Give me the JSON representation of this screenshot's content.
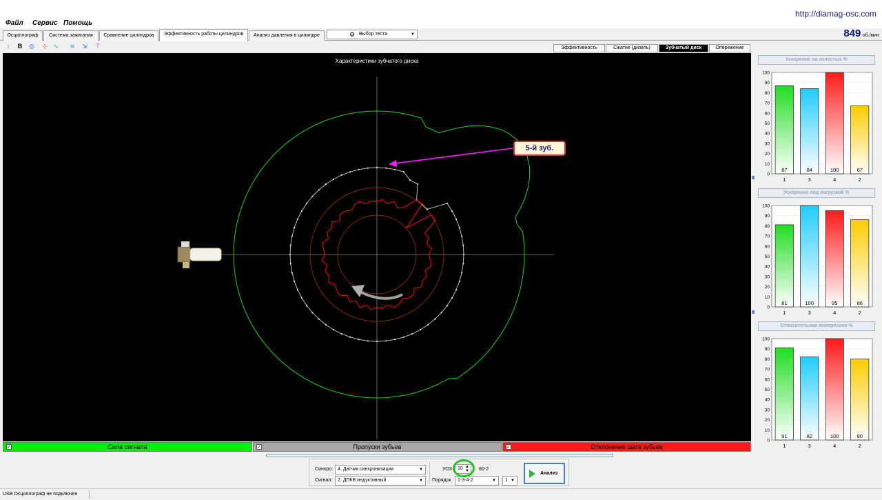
{
  "site_url": "http://diamag-osc.com",
  "menu": [
    "Файл",
    "Сервис",
    "Помощь"
  ],
  "tabs": [
    "Осциллограф",
    "Система зажигания",
    "Сравнение цилиндров",
    "Эффективность работы цилиндров",
    "Анализ давления в цилиндре"
  ],
  "active_tab": 3,
  "test_select": {
    "value": "Выбор теста",
    "icon": "gear-icon"
  },
  "rpm": {
    "value": "849",
    "unit": "об./мин"
  },
  "toolbar_icons": [
    "adjust-icon",
    "bold-b-icon",
    "zoom-icon",
    "cursor-icon",
    "graph-icon",
    "filter-icon",
    "scale-icon",
    "marker-icon"
  ],
  "subtabs": [
    "Эффективность",
    "Сжатие (дизель)",
    "Зубчатый диск",
    "Опережение"
  ],
  "active_subtab": 2,
  "plot": {
    "title": "Характеристики зубчатого диска",
    "callout": "5-й зуб."
  },
  "legend": [
    {
      "label": "Сила сигнала",
      "color": "#00ee00",
      "checked": "✓"
    },
    {
      "label": "Пропуски зубьев",
      "color": "#a0a0a0",
      "checked": "✓"
    },
    {
      "label": "Отклонение шага зубьев",
      "color": "#ff1a1a",
      "checked": "✓"
    }
  ],
  "controls": {
    "sync_label": "Синхро:",
    "sync_value": "4. Датчик синхронизации",
    "signal_label": "Сигнал:",
    "signal_value": "2. ДПКВ индуктивный",
    "uoz_label": "УОЗ",
    "uoz_value": "10",
    "teeth_label": "60-2",
    "order_label": "Порядок",
    "order_value": "1-3-4-2",
    "order_index": "1",
    "analyze_label": "Анализ"
  },
  "status": "USB Осциллограф не подключен",
  "chart_data": [
    {
      "type": "bar",
      "title": "Ускорение на холостых %",
      "categories": [
        "1",
        "3",
        "4",
        "2"
      ],
      "values": [
        87,
        84,
        100,
        67
      ],
      "colors": [
        "#22dd22",
        "#22ccff",
        "#ff1a1a",
        "#ffcc00"
      ],
      "ylim": [
        0,
        100
      ],
      "yticks": [
        0,
        10,
        20,
        30,
        40,
        50,
        60,
        70,
        80,
        90,
        100
      ]
    },
    {
      "type": "bar",
      "title": "Ускорение под нагрузкой %",
      "categories": [
        "1",
        "3",
        "4",
        "2"
      ],
      "values": [
        81,
        100,
        95,
        86
      ],
      "colors": [
        "#22dd22",
        "#22ccff",
        "#ff1a1a",
        "#ffcc00"
      ],
      "ylim": [
        0,
        100
      ],
      "yticks": [
        0,
        10,
        20,
        30,
        40,
        50,
        60,
        70,
        80,
        90,
        100
      ]
    },
    {
      "type": "bar",
      "title": "Относительная компрессия %",
      "categories": [
        "1",
        "3",
        "4",
        "2"
      ],
      "values": [
        91,
        82,
        100,
        80
      ],
      "colors": [
        "#22dd22",
        "#22ccff",
        "#ff1a1a",
        "#ffcc00"
      ],
      "ylim": [
        0,
        100
      ],
      "yticks": [
        0,
        10,
        20,
        30,
        40,
        50,
        60,
        70,
        80,
        90,
        100
      ]
    }
  ]
}
